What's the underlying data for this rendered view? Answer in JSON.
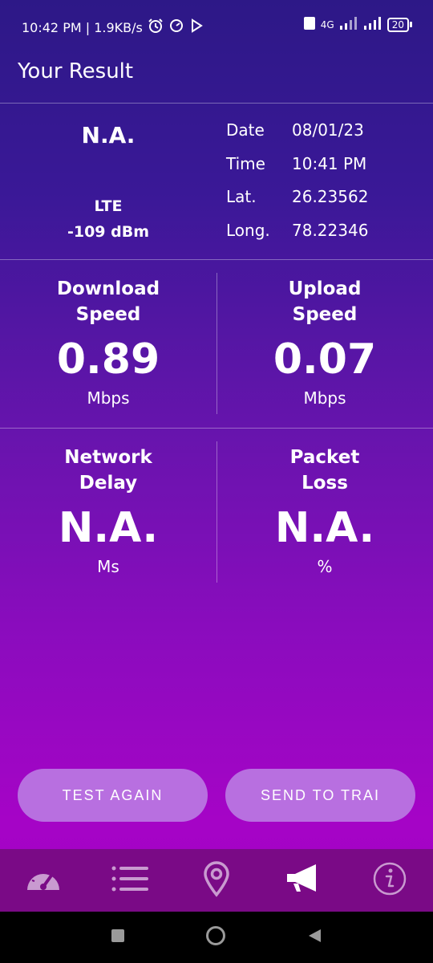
{
  "status_bar": {
    "time_speed": "10:42 PM | 1.9KB/s",
    "network_type": "4G",
    "battery": "20"
  },
  "header": {
    "title": "Your Result"
  },
  "network": {
    "signal_top": "N.A.",
    "technology": "LTE",
    "strength": "-109 dBm"
  },
  "info": [
    {
      "key": "Date",
      "value": "08/01/23"
    },
    {
      "key": "Time",
      "value": "10:41 PM"
    },
    {
      "key": "Lat.",
      "value": "26.23562"
    },
    {
      "key": "Long.",
      "value": "78.22346"
    }
  ],
  "metrics": {
    "download": {
      "label_line1": "Download",
      "label_line2": "Speed",
      "value": "0.89",
      "unit": "Mbps"
    },
    "upload": {
      "label_line1": "Upload",
      "label_line2": "Speed",
      "value": "0.07",
      "unit": "Mbps"
    },
    "delay": {
      "label_line1": "Network",
      "label_line2": "Delay",
      "value": "N.A.",
      "unit": "Ms"
    },
    "loss": {
      "label_line1": "Packet",
      "label_line2": "Loss",
      "value": "N.A.",
      "unit": "%"
    }
  },
  "buttons": {
    "test_again": "TEST AGAIN",
    "send_to_trai": "SEND TO TRAI"
  },
  "bottom_nav": [
    "speedometer-icon",
    "list-icon",
    "location-pin-icon",
    "megaphone-icon",
    "info-icon"
  ],
  "colors": {
    "button_bg": "#b86fe0",
    "nav_bg": "#7a0a86"
  }
}
